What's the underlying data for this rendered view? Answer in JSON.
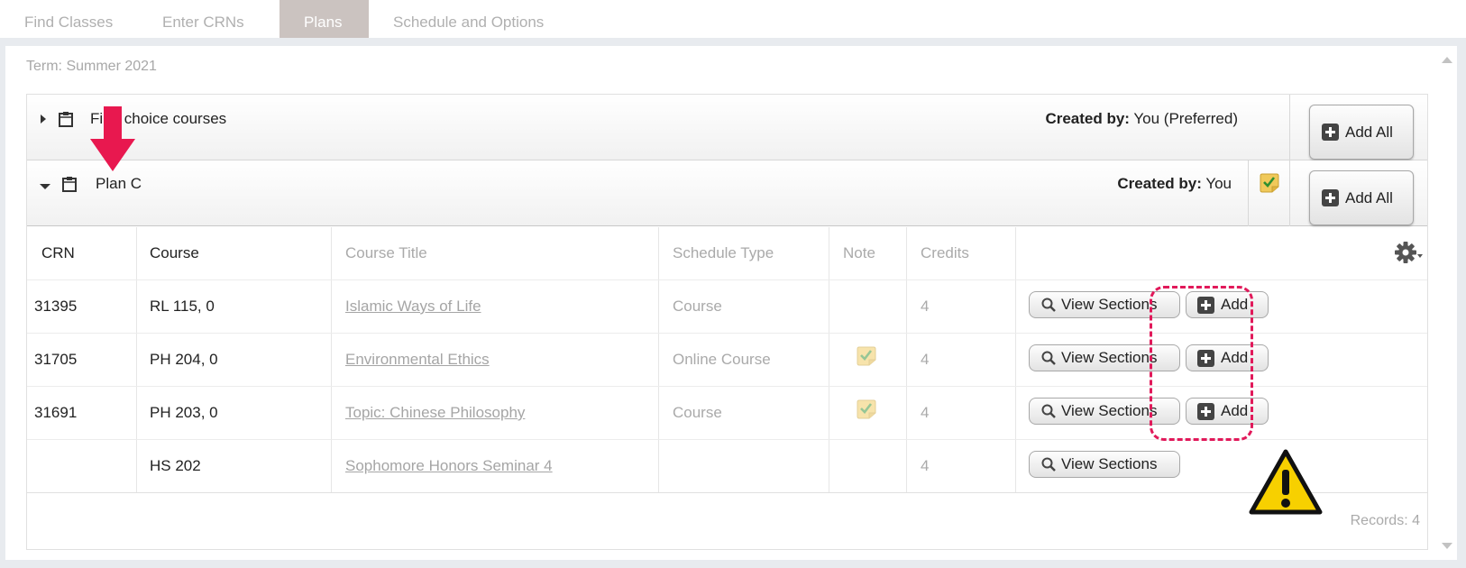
{
  "tabs": [
    {
      "label": "Find Classes",
      "active": false
    },
    {
      "label": "Enter CRNs",
      "active": false
    },
    {
      "label": "Plans",
      "active": true
    },
    {
      "label": "Schedule and Options",
      "active": false
    }
  ],
  "term": "Term: Summer 2021",
  "plans": [
    {
      "name": "First choice courses",
      "created_label": "Created by:",
      "created_value": "You (Preferred)",
      "expanded": false,
      "add_all_label": "Add All"
    },
    {
      "name": "Plan C",
      "created_label": "Created by:",
      "created_value": "You",
      "expanded": true,
      "add_all_label": "Add All"
    }
  ],
  "table": {
    "columns": [
      "CRN",
      "Course",
      "Course Title",
      "Schedule Type",
      "Note",
      "Credits"
    ],
    "view_sections_label": "View Sections",
    "add_label": "Add",
    "rows": [
      {
        "crn": "31395",
        "course": "RL 115, 0",
        "title": "Islamic Ways of Life",
        "schedule_type": "Course",
        "note": false,
        "credits": "4",
        "can_add": true
      },
      {
        "crn": "31705",
        "course": "PH 204, 0",
        "title": "Environmental Ethics",
        "schedule_type": "Online Course",
        "note": true,
        "credits": "4",
        "can_add": true
      },
      {
        "crn": "31691",
        "course": "PH 203, 0",
        "title": "Topic: Chinese Philosophy",
        "schedule_type": "Course",
        "note": true,
        "credits": "4",
        "can_add": true
      },
      {
        "crn": "",
        "course": "HS 202",
        "title": "Sophomore Honors Seminar 4",
        "schedule_type": "",
        "note": false,
        "credits": "4",
        "can_add": false
      }
    ],
    "records": "Records: 4"
  },
  "colors": {
    "accent_annotation": "#e1195a",
    "warning": "#f7d000",
    "active_tab": "#cbc3c0"
  }
}
